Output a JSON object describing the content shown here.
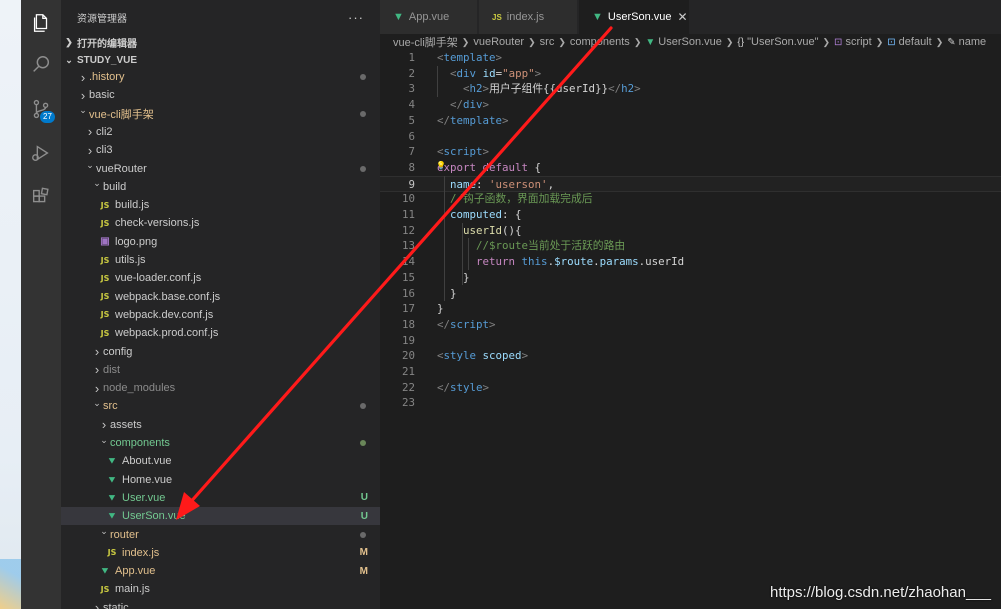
{
  "activity_bar": {
    "items": [
      {
        "icon": "files-icon"
      },
      {
        "icon": "search-icon"
      },
      {
        "icon": "source-control-icon",
        "badge": "27"
      },
      {
        "icon": "run-debug-icon"
      },
      {
        "icon": "extensions-icon"
      }
    ]
  },
  "explorer": {
    "title": "资源管理器",
    "more": "···",
    "open_editors_label": "打开的编辑器",
    "workspace_label": "STUDY_VUE",
    "tree": [
      {
        "label": ".history",
        "kind": "folder",
        "open": false,
        "depth": 0,
        "color": "yellow",
        "decor": "dot"
      },
      {
        "label": "basic",
        "kind": "folder",
        "open": false,
        "depth": 0
      },
      {
        "label": "vue-cli脚手架",
        "kind": "folder",
        "open": true,
        "depth": 0,
        "color": "yellow",
        "decor": "dot"
      },
      {
        "label": "cli2",
        "kind": "folder",
        "open": false,
        "depth": 1
      },
      {
        "label": "cli3",
        "kind": "folder",
        "open": false,
        "depth": 1
      },
      {
        "label": "vueRouter",
        "kind": "folder",
        "open": true,
        "depth": 1,
        "decor": "dot"
      },
      {
        "label": "build",
        "kind": "folder",
        "open": true,
        "depth": 2
      },
      {
        "label": "build.js",
        "kind": "js",
        "depth": 3
      },
      {
        "label": "check-versions.js",
        "kind": "js",
        "depth": 3
      },
      {
        "label": "logo.png",
        "kind": "img",
        "depth": 3
      },
      {
        "label": "utils.js",
        "kind": "js",
        "depth": 3
      },
      {
        "label": "vue-loader.conf.js",
        "kind": "js",
        "depth": 3
      },
      {
        "label": "webpack.base.conf.js",
        "kind": "js",
        "depth": 3
      },
      {
        "label": "webpack.dev.conf.js",
        "kind": "js",
        "depth": 3
      },
      {
        "label": "webpack.prod.conf.js",
        "kind": "js",
        "depth": 3
      },
      {
        "label": "config",
        "kind": "folder",
        "open": false,
        "depth": 2
      },
      {
        "label": "dist",
        "kind": "folder",
        "open": false,
        "depth": 2,
        "color": "dim"
      },
      {
        "label": "node_modules",
        "kind": "folder",
        "open": false,
        "depth": 2,
        "color": "dim"
      },
      {
        "label": "src",
        "kind": "folder",
        "open": true,
        "depth": 2,
        "color": "yellow",
        "decor": "dot"
      },
      {
        "label": "assets",
        "kind": "folder",
        "open": false,
        "depth": 3
      },
      {
        "label": "components",
        "kind": "folder",
        "open": true,
        "depth": 3,
        "color": "green",
        "decor": "dot-green"
      },
      {
        "label": "About.vue",
        "kind": "vue",
        "depth": 4
      },
      {
        "label": "Home.vue",
        "kind": "vue",
        "depth": 4
      },
      {
        "label": "User.vue",
        "kind": "vue",
        "depth": 4,
        "color": "green",
        "status": "U"
      },
      {
        "label": "UserSon.vue",
        "kind": "vue",
        "depth": 4,
        "color": "green",
        "status": "U",
        "selected": true
      },
      {
        "label": "router",
        "kind": "folder",
        "open": true,
        "depth": 3,
        "color": "yellow",
        "decor": "dot"
      },
      {
        "label": "index.js",
        "kind": "js",
        "depth": 4,
        "color": "yellow",
        "status": "M"
      },
      {
        "label": "App.vue",
        "kind": "vue",
        "depth": 3,
        "color": "yellow",
        "status": "M"
      },
      {
        "label": "main.js",
        "kind": "js",
        "depth": 3
      },
      {
        "label": "static",
        "kind": "folder",
        "open": false,
        "depth": 2
      }
    ]
  },
  "tabs": [
    {
      "label": "App.vue",
      "kind": "vue",
      "active": false
    },
    {
      "label": "index.js",
      "kind": "js",
      "active": false
    },
    {
      "label": "UserSon.vue",
      "kind": "vue",
      "active": true,
      "close": "✕"
    }
  ],
  "breadcrumb": [
    {
      "label": "vue-cli脚手架",
      "icon": ""
    },
    {
      "label": "vueRouter",
      "icon": ""
    },
    {
      "label": "src",
      "icon": ""
    },
    {
      "label": "components",
      "icon": ""
    },
    {
      "label": "UserSon.vue",
      "icon": "vue"
    },
    {
      "label": "\"UserSon.vue\"",
      "icon": "braces"
    },
    {
      "label": "script",
      "icon": "symbol"
    },
    {
      "label": "default",
      "icon": "symbol"
    },
    {
      "label": "name",
      "icon": "wrench"
    }
  ],
  "code": {
    "current_line": 9,
    "lines": [
      [
        [
          "t-br",
          "<"
        ],
        [
          "t-tag",
          "template"
        ],
        [
          "t-br",
          ">"
        ]
      ],
      [
        [
          "t-txt",
          "  "
        ],
        [
          "t-br",
          "<"
        ],
        [
          "t-tag",
          "div"
        ],
        [
          "t-txt",
          " "
        ],
        [
          "t-attr",
          "id"
        ],
        [
          "t-txt",
          "="
        ],
        [
          "t-str",
          "\"app\""
        ],
        [
          "t-br",
          ">"
        ]
      ],
      [
        [
          "t-txt",
          "    "
        ],
        [
          "t-br",
          "<"
        ],
        [
          "t-tag",
          "h2"
        ],
        [
          "t-br",
          ">"
        ],
        [
          "t-txt",
          "用户子组件{{userId}}"
        ],
        [
          "t-br",
          "</"
        ],
        [
          "t-tag",
          "h2"
        ],
        [
          "t-br",
          ">"
        ]
      ],
      [
        [
          "t-txt",
          "  "
        ],
        [
          "t-br",
          "</"
        ],
        [
          "t-tag",
          "div"
        ],
        [
          "t-br",
          ">"
        ]
      ],
      [
        [
          "t-br",
          "</"
        ],
        [
          "t-tag",
          "template"
        ],
        [
          "t-br",
          ">"
        ]
      ],
      [],
      [
        [
          "t-br",
          "<"
        ],
        [
          "t-tag",
          "script"
        ],
        [
          "t-br",
          ">"
        ]
      ],
      [
        [
          "t-kw",
          "export"
        ],
        [
          "t-txt",
          " "
        ],
        [
          "t-kw",
          "default"
        ],
        [
          "t-txt",
          " {"
        ]
      ],
      [
        [
          "t-txt",
          "  "
        ],
        [
          "t-key",
          "name"
        ],
        [
          "t-txt",
          ": "
        ],
        [
          "t-str",
          "'userson'"
        ],
        [
          "t-txt",
          ","
        ]
      ],
      [
        [
          "t-txt",
          "  "
        ],
        [
          "t-com",
          "//钩子函数，界面加载完成后"
        ]
      ],
      [
        [
          "t-txt",
          "  "
        ],
        [
          "t-key",
          "computed"
        ],
        [
          "t-txt",
          ": {"
        ]
      ],
      [
        [
          "t-txt",
          "    "
        ],
        [
          "t-fn",
          "userId"
        ],
        [
          "t-txt",
          "(){"
        ]
      ],
      [
        [
          "t-txt",
          "      "
        ],
        [
          "t-com",
          "//$route当前处于活跃的路由"
        ]
      ],
      [
        [
          "t-txt",
          "      "
        ],
        [
          "t-kw",
          "return"
        ],
        [
          "t-txt",
          " "
        ],
        [
          "t-this",
          "this"
        ],
        [
          "t-txt",
          "."
        ],
        [
          "t-var",
          "$route"
        ],
        [
          "t-txt",
          "."
        ],
        [
          "t-var",
          "params"
        ],
        [
          "t-txt",
          "."
        ],
        [
          "t-txt",
          "userId"
        ]
      ],
      [
        [
          "t-txt",
          "    }"
        ]
      ],
      [
        [
          "t-txt",
          "  }"
        ]
      ],
      [
        [
          "t-txt",
          "}"
        ]
      ],
      [
        [
          "t-br",
          "</"
        ],
        [
          "t-tag",
          "script"
        ],
        [
          "t-br",
          ">"
        ]
      ],
      [],
      [
        [
          "t-br",
          "<"
        ],
        [
          "t-tag",
          "style"
        ],
        [
          "t-txt",
          " "
        ],
        [
          "t-attr",
          "scoped"
        ],
        [
          "t-br",
          ">"
        ]
      ],
      [],
      [
        [
          "t-br",
          "</"
        ],
        [
          "t-tag",
          "style"
        ],
        [
          "t-br",
          ">"
        ]
      ],
      []
    ]
  },
  "watermark": "https://blog.csdn.net/zhaohan___",
  "colors": {
    "annotation_arrow": "#ff1a1a",
    "vue_green": "#41b883",
    "js_yellow": "#cbcb41",
    "accent": "#007acc"
  }
}
